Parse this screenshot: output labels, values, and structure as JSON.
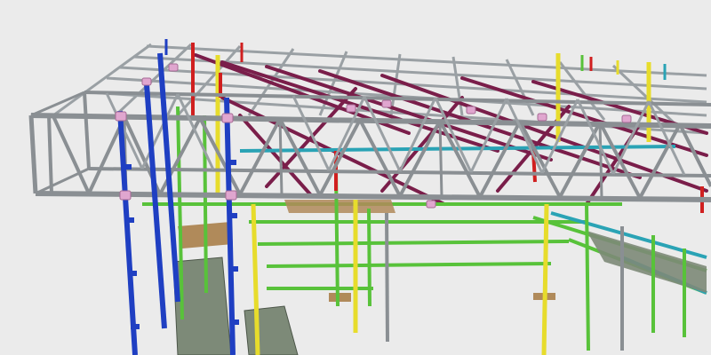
{
  "scene": {
    "subject": "scaffolding-roof-truss-3d-model",
    "colors": {
      "background": "#ebebeb",
      "truss": "#8a8f93",
      "truss_dark": "#5f6468",
      "brace": "#7a1e4a",
      "standard_blue": "#1f3fc2",
      "standard_red": "#d01f1f",
      "standard_yellow": "#e7dc2c",
      "ledger_green": "#58c23a",
      "transom_teal": "#2aa3b5",
      "plank": "#7d8a78",
      "plank_wood": "#b08a5a",
      "coupler": "#e0a6cf"
    }
  }
}
